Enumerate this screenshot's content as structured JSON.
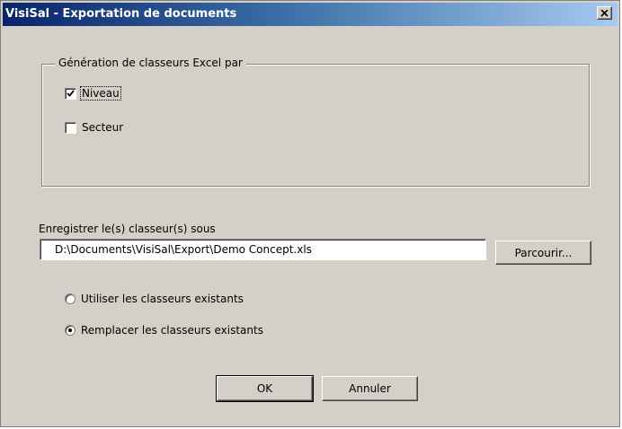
{
  "window": {
    "title": "VisiSal - Exportation de documents",
    "close_icon": "close-icon"
  },
  "generation_group": {
    "legend": "Génération de classeurs Excel par",
    "options": [
      {
        "label": "Niveau",
        "checked": true
      },
      {
        "label": "Secteur",
        "checked": false
      }
    ]
  },
  "save_as": {
    "label": "Enregistrer le(s) classeur(s) sous",
    "path_value": "D:\\Documents\\VisiSal\\Export\\Demo Concept.xls",
    "browse_label": "Parcourir..."
  },
  "existing_mode": {
    "options": [
      {
        "label": "Utiliser les classeurs existants",
        "selected": false
      },
      {
        "label": "Remplacer les classeurs existants",
        "selected": true
      }
    ]
  },
  "buttons": {
    "ok_label": "OK",
    "cancel_label": "Annuler"
  },
  "colors": {
    "face": "#d4d0c8",
    "title_start": "#0a246a",
    "title_end": "#a6caf0"
  }
}
